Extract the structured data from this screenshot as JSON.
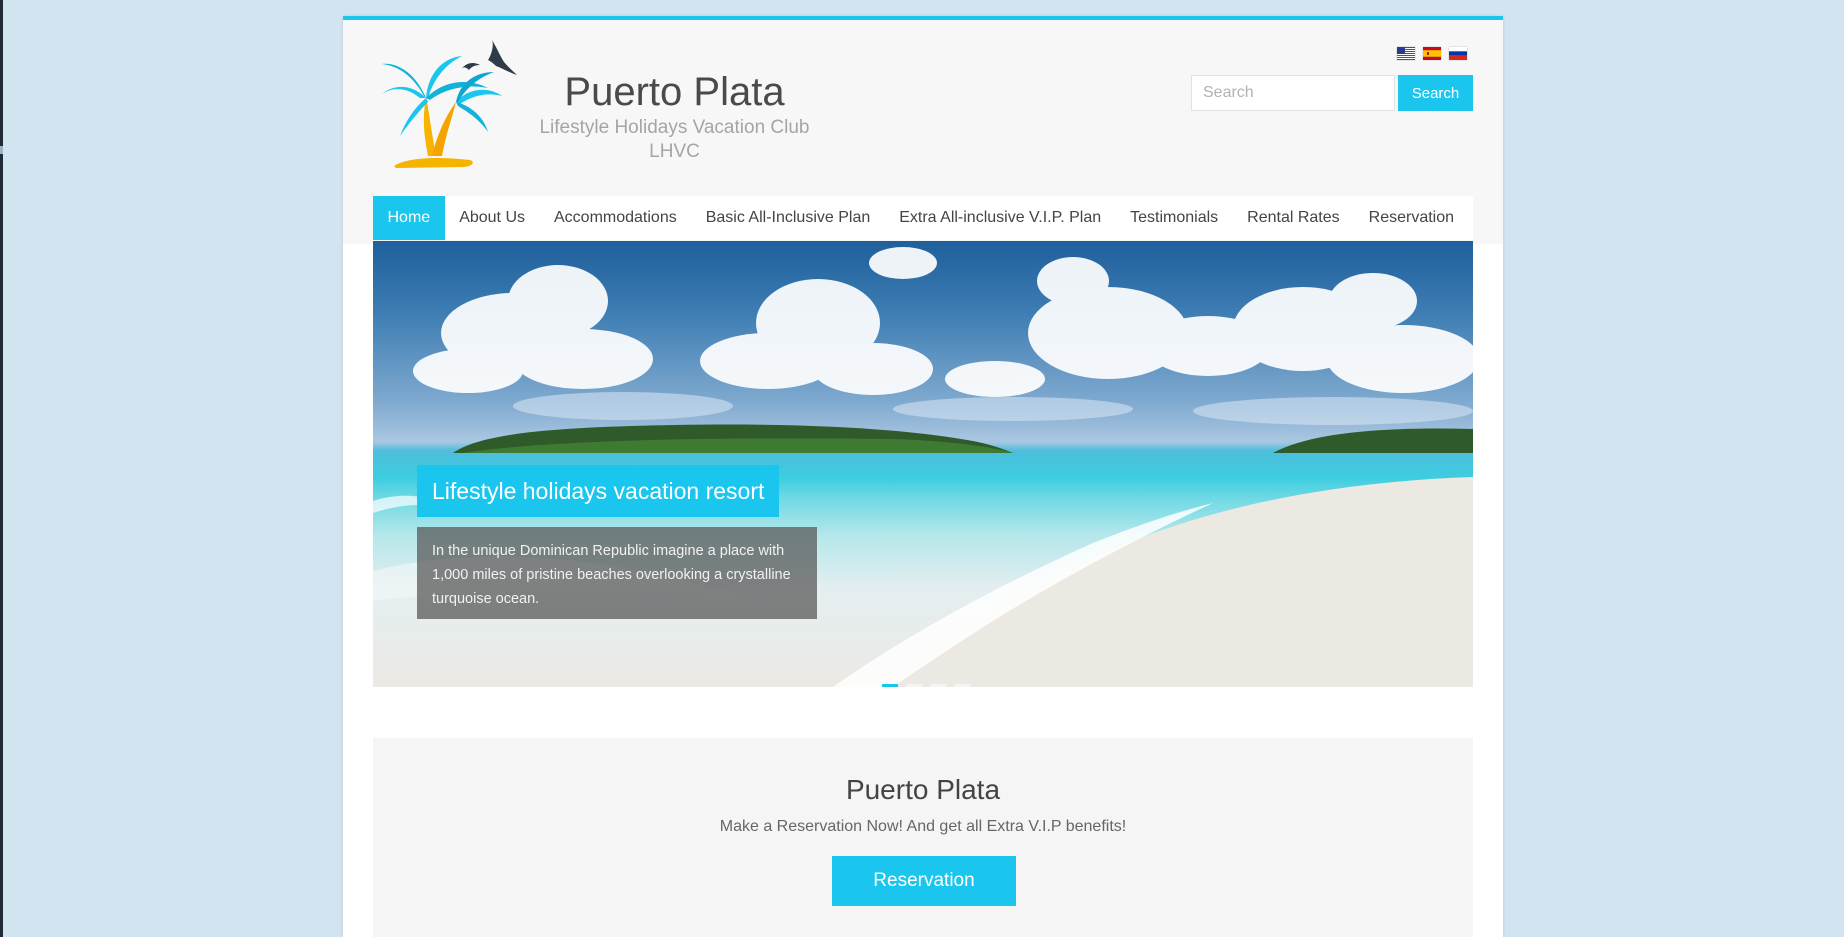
{
  "site": {
    "title": "Puerto Plata",
    "description": "Lifestyle Holidays Vacation Club LHVC"
  },
  "languages": [
    {
      "icon": "us-flag-icon",
      "code": "en"
    },
    {
      "icon": "spain-flag-icon",
      "code": "es"
    },
    {
      "icon": "russia-flag-icon",
      "code": "ru"
    }
  ],
  "search": {
    "placeholder": "Search",
    "button_label": "Search"
  },
  "nav": {
    "items": [
      {
        "label": "Home",
        "active": true
      },
      {
        "label": "About Us"
      },
      {
        "label": "Accommodations"
      },
      {
        "label": "Basic All-Inclusive Plan"
      },
      {
        "label": "Extra All-inclusive V.I.P. Plan"
      },
      {
        "label": "Testimonials"
      },
      {
        "label": "Rental Rates"
      },
      {
        "label": "Reservation"
      }
    ]
  },
  "hero": {
    "caption_title": "Lifestyle holidays vacation resort",
    "caption_text": "In the unique Dominican Republic imagine a place with 1,000 miles of pristine beaches overlooking a crystalline turquoise ocean.",
    "slide_count": 4,
    "active_slide": 1
  },
  "cta": {
    "title": "Puerto Plata",
    "subtitle": "Make a Reservation Now! And get all Extra V.I.P benefits!",
    "button_label": "Reservation"
  },
  "colors": {
    "accent": "#1ac6ee",
    "background": "#d3e4f1"
  }
}
